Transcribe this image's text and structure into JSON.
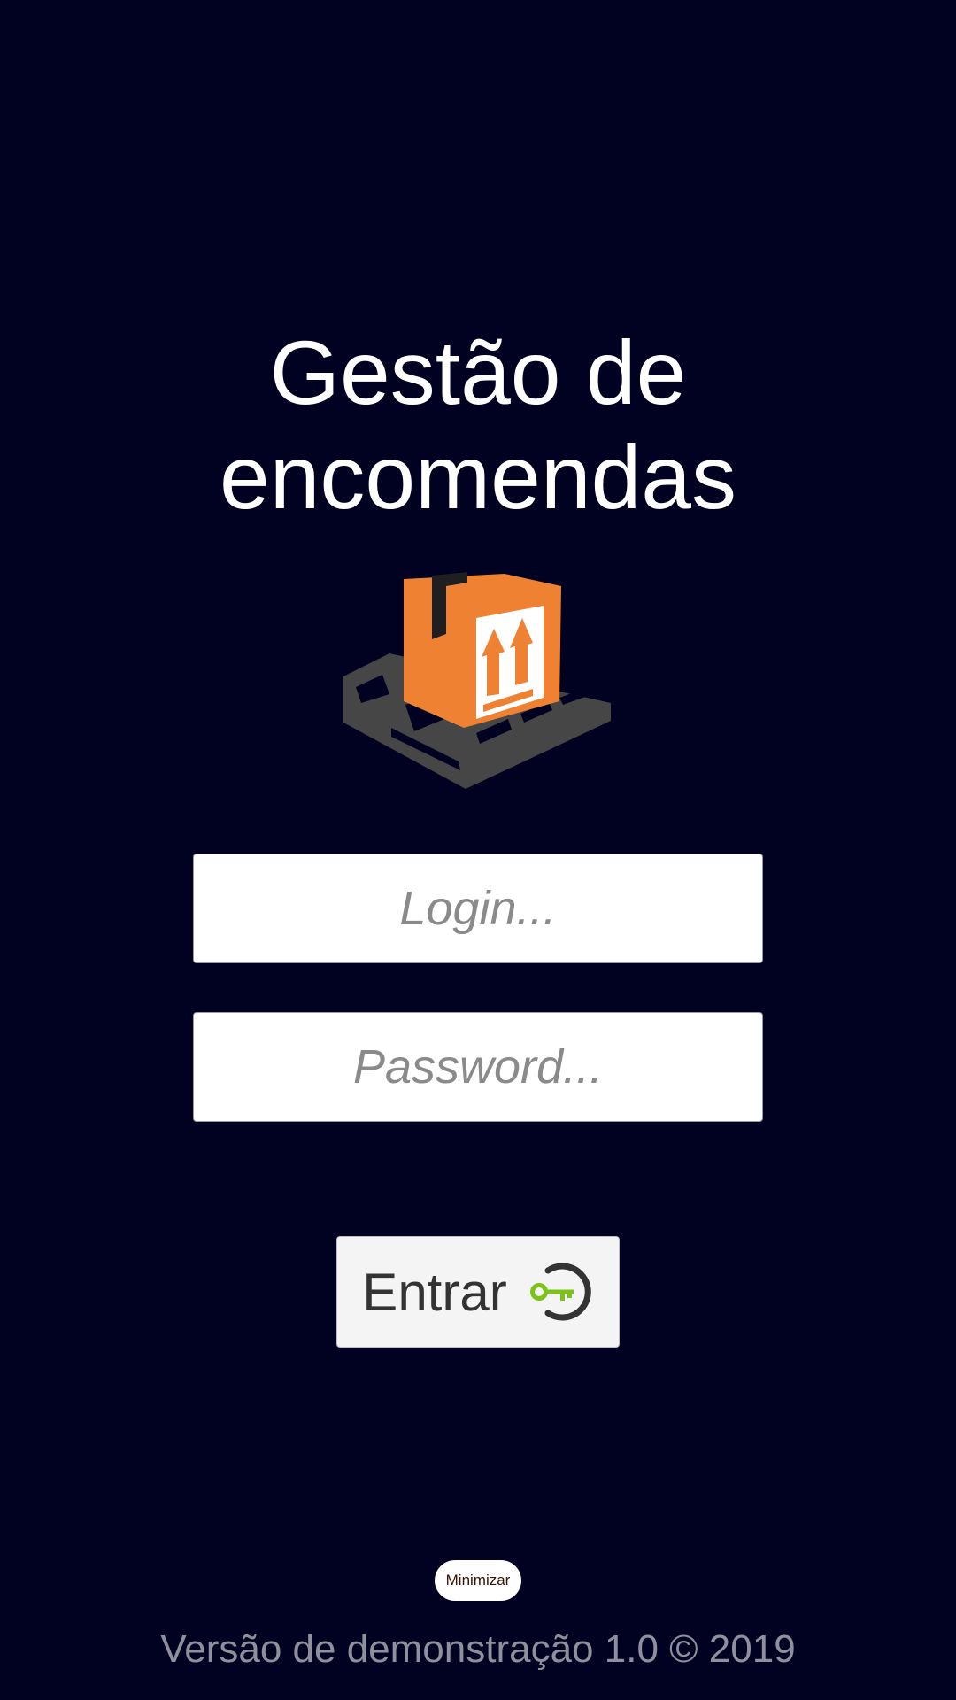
{
  "app": {
    "title_line1": "Gestão de",
    "title_line2": "encomendas",
    "logo_icon": "package-on-pallet-icon"
  },
  "form": {
    "login_placeholder": "Login...",
    "login_value": "",
    "password_placeholder": "Password...",
    "password_value": "",
    "enter_label": "Entrar",
    "enter_icon": "key-icon"
  },
  "footer": {
    "minimize_label": "Minimizar",
    "version_text": "Versão de demonstração 1.0 © 2019"
  },
  "colors": {
    "background": "#010121",
    "box_orange": "#ef8232",
    "pallet_gray": "#464646",
    "key_green": "#7cc21b"
  }
}
